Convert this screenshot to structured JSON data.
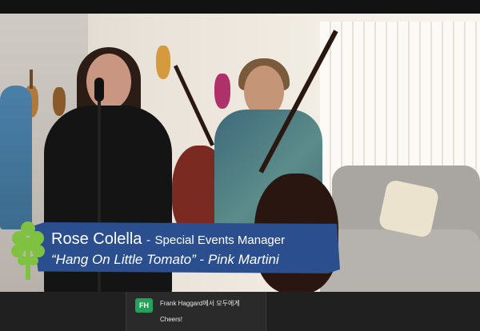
{
  "lower_third": {
    "name": "Rose Colella",
    "separator": "-",
    "role": "Special Events Manager",
    "song": "“Hang On Little Tomato”",
    "song_separator": "-",
    "artist": "Pink Martini"
  },
  "chat_notification": {
    "avatar_initials": "FH",
    "sender": "Frank  Haggard에서 모두에게",
    "message": "Cheers!",
    "avatar_color": "#23a35a"
  },
  "colors": {
    "banner": "#2b4f8e",
    "logo": "#7fc241"
  }
}
